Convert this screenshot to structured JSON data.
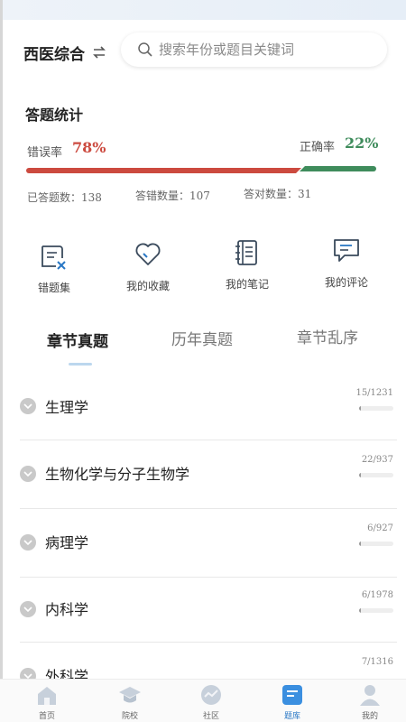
{
  "header": {
    "subject": "西医综合",
    "search_placeholder": "搜索年份或题目关键词"
  },
  "stats": {
    "title": "答题统计",
    "error_label": "错误率",
    "error_value": "78%",
    "correct_label": "正确率",
    "correct_value": "22%",
    "error_fraction": 0.78,
    "answered_label": "已答题数：",
    "answered_value": "138",
    "wrong_label": "答错数量：",
    "wrong_value": "107",
    "right_label": "答对数量：",
    "right_value": "31",
    "colors": {
      "error": "#cc4a3f",
      "correct": "#3f8c5c"
    }
  },
  "tools": [
    {
      "label": "错题集",
      "icon": "wrong-set-icon"
    },
    {
      "label": "我的收藏",
      "icon": "heart-icon"
    },
    {
      "label": "我的笔记",
      "icon": "notebook-icon"
    },
    {
      "label": "我的评论",
      "icon": "comment-icon"
    }
  ],
  "tabs": [
    {
      "label": "章节真题",
      "active": true
    },
    {
      "label": "历年真题",
      "active": false
    },
    {
      "label": "章节乱序",
      "active": false
    }
  ],
  "chapters": [
    {
      "name": "生理学",
      "count": "15/1231",
      "progress": 0.012
    },
    {
      "name": "生物化学与分子生物学",
      "count": "22/937",
      "progress": 0.023
    },
    {
      "name": "病理学",
      "count": "6/927",
      "progress": 0.006
    },
    {
      "name": "内科学",
      "count": "6/1978",
      "progress": 0.003
    },
    {
      "name": "外科学",
      "count": "7/1316",
      "progress": 0.005
    }
  ],
  "bottom_nav": [
    {
      "label": "首页",
      "icon": "home-icon",
      "active": false
    },
    {
      "label": "院校",
      "icon": "graduation-cap-icon",
      "active": false
    },
    {
      "label": "社区",
      "icon": "community-icon",
      "active": false
    },
    {
      "label": "题库",
      "icon": "question-bank-icon",
      "active": true
    },
    {
      "label": "我的",
      "icon": "profile-icon",
      "active": false
    }
  ]
}
